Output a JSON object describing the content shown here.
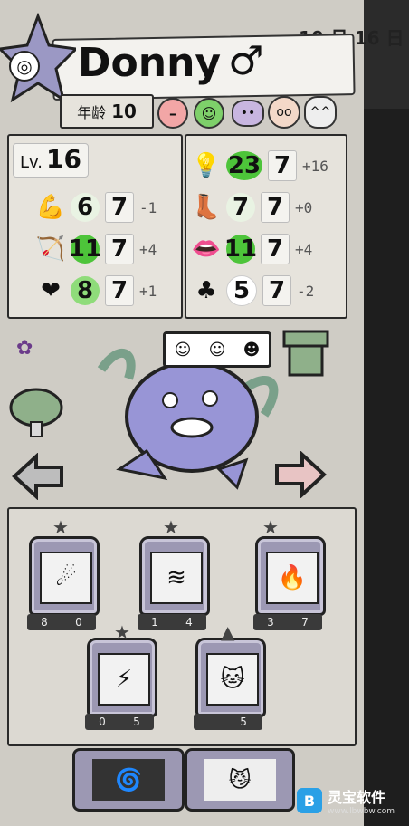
{
  "header": {
    "date": "10 月 16 日",
    "name": "Donny",
    "gender_symbol": "♂",
    "age_label": "年龄",
    "age_value": "10",
    "emblem_icon": "spiral-icon"
  },
  "moods": [
    "meh-face-icon",
    "happy-face-icon",
    "sad-face-icon",
    "pig-face-icon",
    "cat-face-icon"
  ],
  "level": {
    "label": "Lv.",
    "value": "16"
  },
  "stats_left": [
    {
      "icon": "strength-arm-icon",
      "glyph": "💪",
      "value": "6",
      "box": "7",
      "delta": "-1",
      "color": "#e9f3e3"
    },
    {
      "icon": "bow-arrow-icon",
      "glyph": "🏹",
      "value": "11",
      "box": "7",
      "delta": "+4",
      "color": "#4dc43a"
    },
    {
      "icon": "heart-plus-icon",
      "glyph": "❤",
      "value": "8",
      "box": "7",
      "delta": "+1",
      "color": "#8fdc7a"
    }
  ],
  "stats_right": [
    {
      "icon": "lightbulb-icon",
      "glyph": "💡",
      "value": "23",
      "box": "7",
      "delta": "+16",
      "color": "#4dc43a"
    },
    {
      "icon": "boot-icon",
      "glyph": "👢",
      "value": "7",
      "box": "7",
      "delta": "+0",
      "color": "#e9f3e3"
    },
    {
      "icon": "lips-icon",
      "glyph": "👄",
      "value": "11",
      "box": "7",
      "delta": "+4",
      "color": "#4dc43a"
    },
    {
      "icon": "clover-icon",
      "glyph": "♣",
      "value": "5",
      "box": "7",
      "delta": "-2",
      "color": "#ffffff"
    }
  ],
  "skills_row1": [
    {
      "name": "shooting-star-skill",
      "glyph": "☄",
      "a": "8",
      "b": "0"
    },
    {
      "name": "wind-gust-skill",
      "glyph": "≋",
      "a": "1",
      "b": "4"
    },
    {
      "name": "flame-blast-skill",
      "glyph": "🔥",
      "a": "3",
      "b": "7"
    }
  ],
  "skills_row2": [
    {
      "name": "lightning-skill",
      "glyph": "⚡",
      "a": "0",
      "b": "5"
    },
    {
      "name": "cat-summon-skill",
      "glyph": "🐱",
      "a": "",
      "b": "5"
    }
  ],
  "skills_row3": [
    {
      "name": "vortex-skill",
      "glyph": "🌀"
    },
    {
      "name": "shadow-cat-skill",
      "glyph": "😼"
    }
  ],
  "watermark": {
    "brand": "灵宝软件",
    "url": "www.lbwbw.com"
  }
}
